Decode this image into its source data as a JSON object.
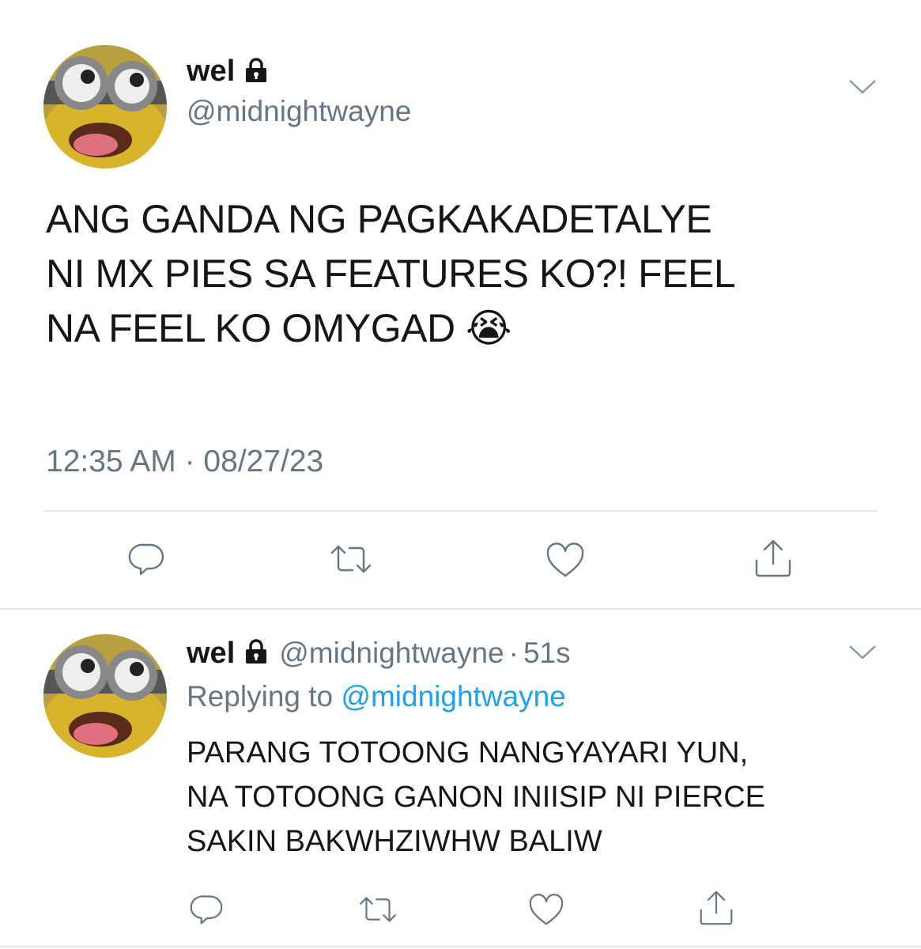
{
  "main_tweet": {
    "display_name": "wel",
    "handle": "@midnightwayne",
    "text_lines": [
      "ANG GANDA NG PAGKAKADETALYE",
      "NI MX PIES SA FEATURES KO?! FEEL",
      "NA FEEL KO OMYGAD"
    ],
    "emoji": "😭",
    "timestamp": "12:35 AM · 08/27/23"
  },
  "reply_tweet": {
    "display_name": "wel",
    "handle": "@midnightwayne",
    "separator": "·",
    "age": "51s",
    "replying_prefix": "Replying to",
    "replying_handle": "@midnightwayne",
    "text_lines": [
      "PARANG TOTOONG NANGYAYARI YUN,",
      "NA TOTOONG GANON INIISIP NI PIERCE",
      "SAKIN BAKWHZIWHW BALIW"
    ]
  },
  "icons": {
    "lock": "lock-icon",
    "chevron": "chevron-down-icon",
    "reply": "reply-icon",
    "retweet": "retweet-icon",
    "like": "heart-icon",
    "share": "share-icon"
  },
  "colors": {
    "text": "#14171a",
    "muted": "#657786",
    "link": "#1da1f2",
    "divider": "#e1e8ed"
  }
}
